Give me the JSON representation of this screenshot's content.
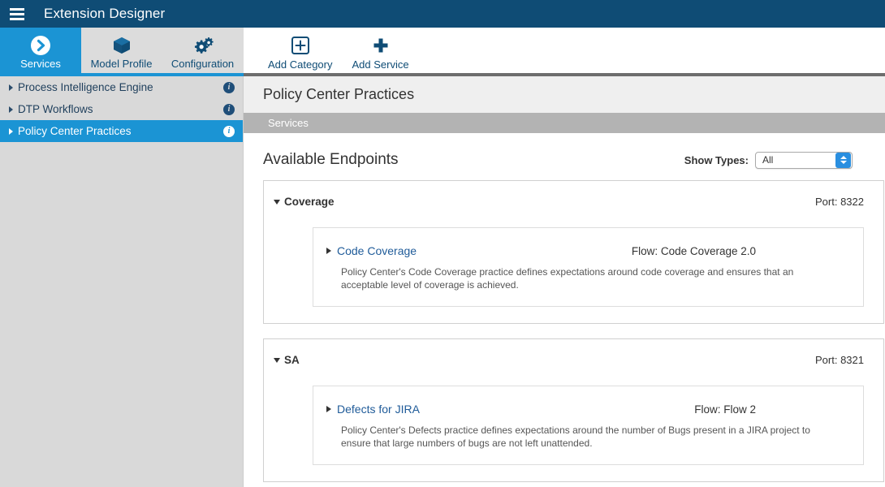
{
  "titlebar": {
    "menu_icon": "hamburger-menu-icon",
    "app_title": "Extension Designer"
  },
  "tabs": [
    {
      "id": "services",
      "label": "Services",
      "icon": "chevron-circle-right-icon",
      "selected": true
    },
    {
      "id": "model-profile",
      "label": "Model Profile",
      "icon": "cube-icon",
      "selected": false
    },
    {
      "id": "configuration",
      "label": "Configuration",
      "icon": "gears-icon",
      "selected": false
    }
  ],
  "toolbar": [
    {
      "id": "add-category",
      "label": "Add Category",
      "icon": "plus-box-icon"
    },
    {
      "id": "add-service",
      "label": "Add Service",
      "icon": "plus-icon"
    }
  ],
  "sidebar": {
    "items": [
      {
        "label": "Process Intelligence Engine",
        "selected": false,
        "info_icon": "info-icon"
      },
      {
        "label": "DTP Workflows",
        "selected": false,
        "info_icon": "info-icon"
      },
      {
        "label": "Policy Center Practices",
        "selected": true,
        "info_icon": "info-icon"
      }
    ]
  },
  "main": {
    "page_title": "Policy Center Practices",
    "breadcrumb": "Services",
    "section_title": "Available Endpoints",
    "show_types": {
      "label": "Show Types:",
      "value": "All",
      "options": [
        "All"
      ]
    },
    "cards": [
      {
        "title": "Coverage",
        "port": "Port: 8322",
        "expanded": true,
        "items": [
          {
            "name": "Code Coverage",
            "flow": "Flow: Code Coverage 2.0",
            "description": "Policy Center's Code Coverage practice defines expectations around code coverage and ensures that an acceptable level of coverage is achieved."
          }
        ]
      },
      {
        "title": "SA",
        "port": "Port: 8321",
        "expanded": true,
        "items": [
          {
            "name": "Defects for JIRA",
            "flow": "Flow: Flow 2",
            "description": "Policy Center's Defects practice defines expectations around the number of Bugs present in a JIRA project to ensure that large numbers of bugs are not left unattended."
          }
        ]
      }
    ]
  },
  "colors": {
    "titlebar_bg": "#0f4c75",
    "accent_blue": "#1b94d4",
    "tab_grey": "#dcdcdc",
    "sidebar_bg": "#d9d9d9",
    "crumb_bg": "#b3b3b3",
    "link_blue": "#1f5b99"
  }
}
